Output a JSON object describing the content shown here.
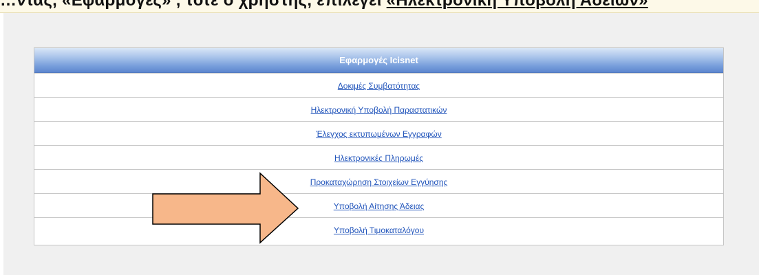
{
  "top_banner": {
    "text": "…ντας, «Εφαρμογές» ,  τότε ο χρήστης, επιλέγει ",
    "link_text": "«Ηλεκτρονική Υποβολή Αδειών»"
  },
  "apps_panel": {
    "title": "Εφαρμογές Icisnet",
    "items": [
      {
        "label": "Δοκιμές Συμβατότητας"
      },
      {
        "label": "Ηλεκτρονική Υποβολή Παραστατικών"
      },
      {
        "label": "Έλεγχος εκτυπωμένων Εγγραφών"
      },
      {
        "label": "Ηλεκτρονικές Πληρωμές"
      },
      {
        "label": "Προκαταχώρηση Στοιχείων Εγγύησης"
      },
      {
        "label": "Υποβολή Αίτησης Άδειας"
      },
      {
        "label": "Υποβολή Τιμοκαταλόγου"
      }
    ]
  },
  "annotation": {
    "icon": "right-arrow-icon",
    "fill_color": "#f7b78a",
    "stroke_color": "#000000"
  },
  "colors": {
    "header_gradient_top": "#d9e6f7",
    "header_gradient_bottom": "#5d86cf",
    "link_color": "#2255bb",
    "page_background": "#f0f0f0"
  }
}
